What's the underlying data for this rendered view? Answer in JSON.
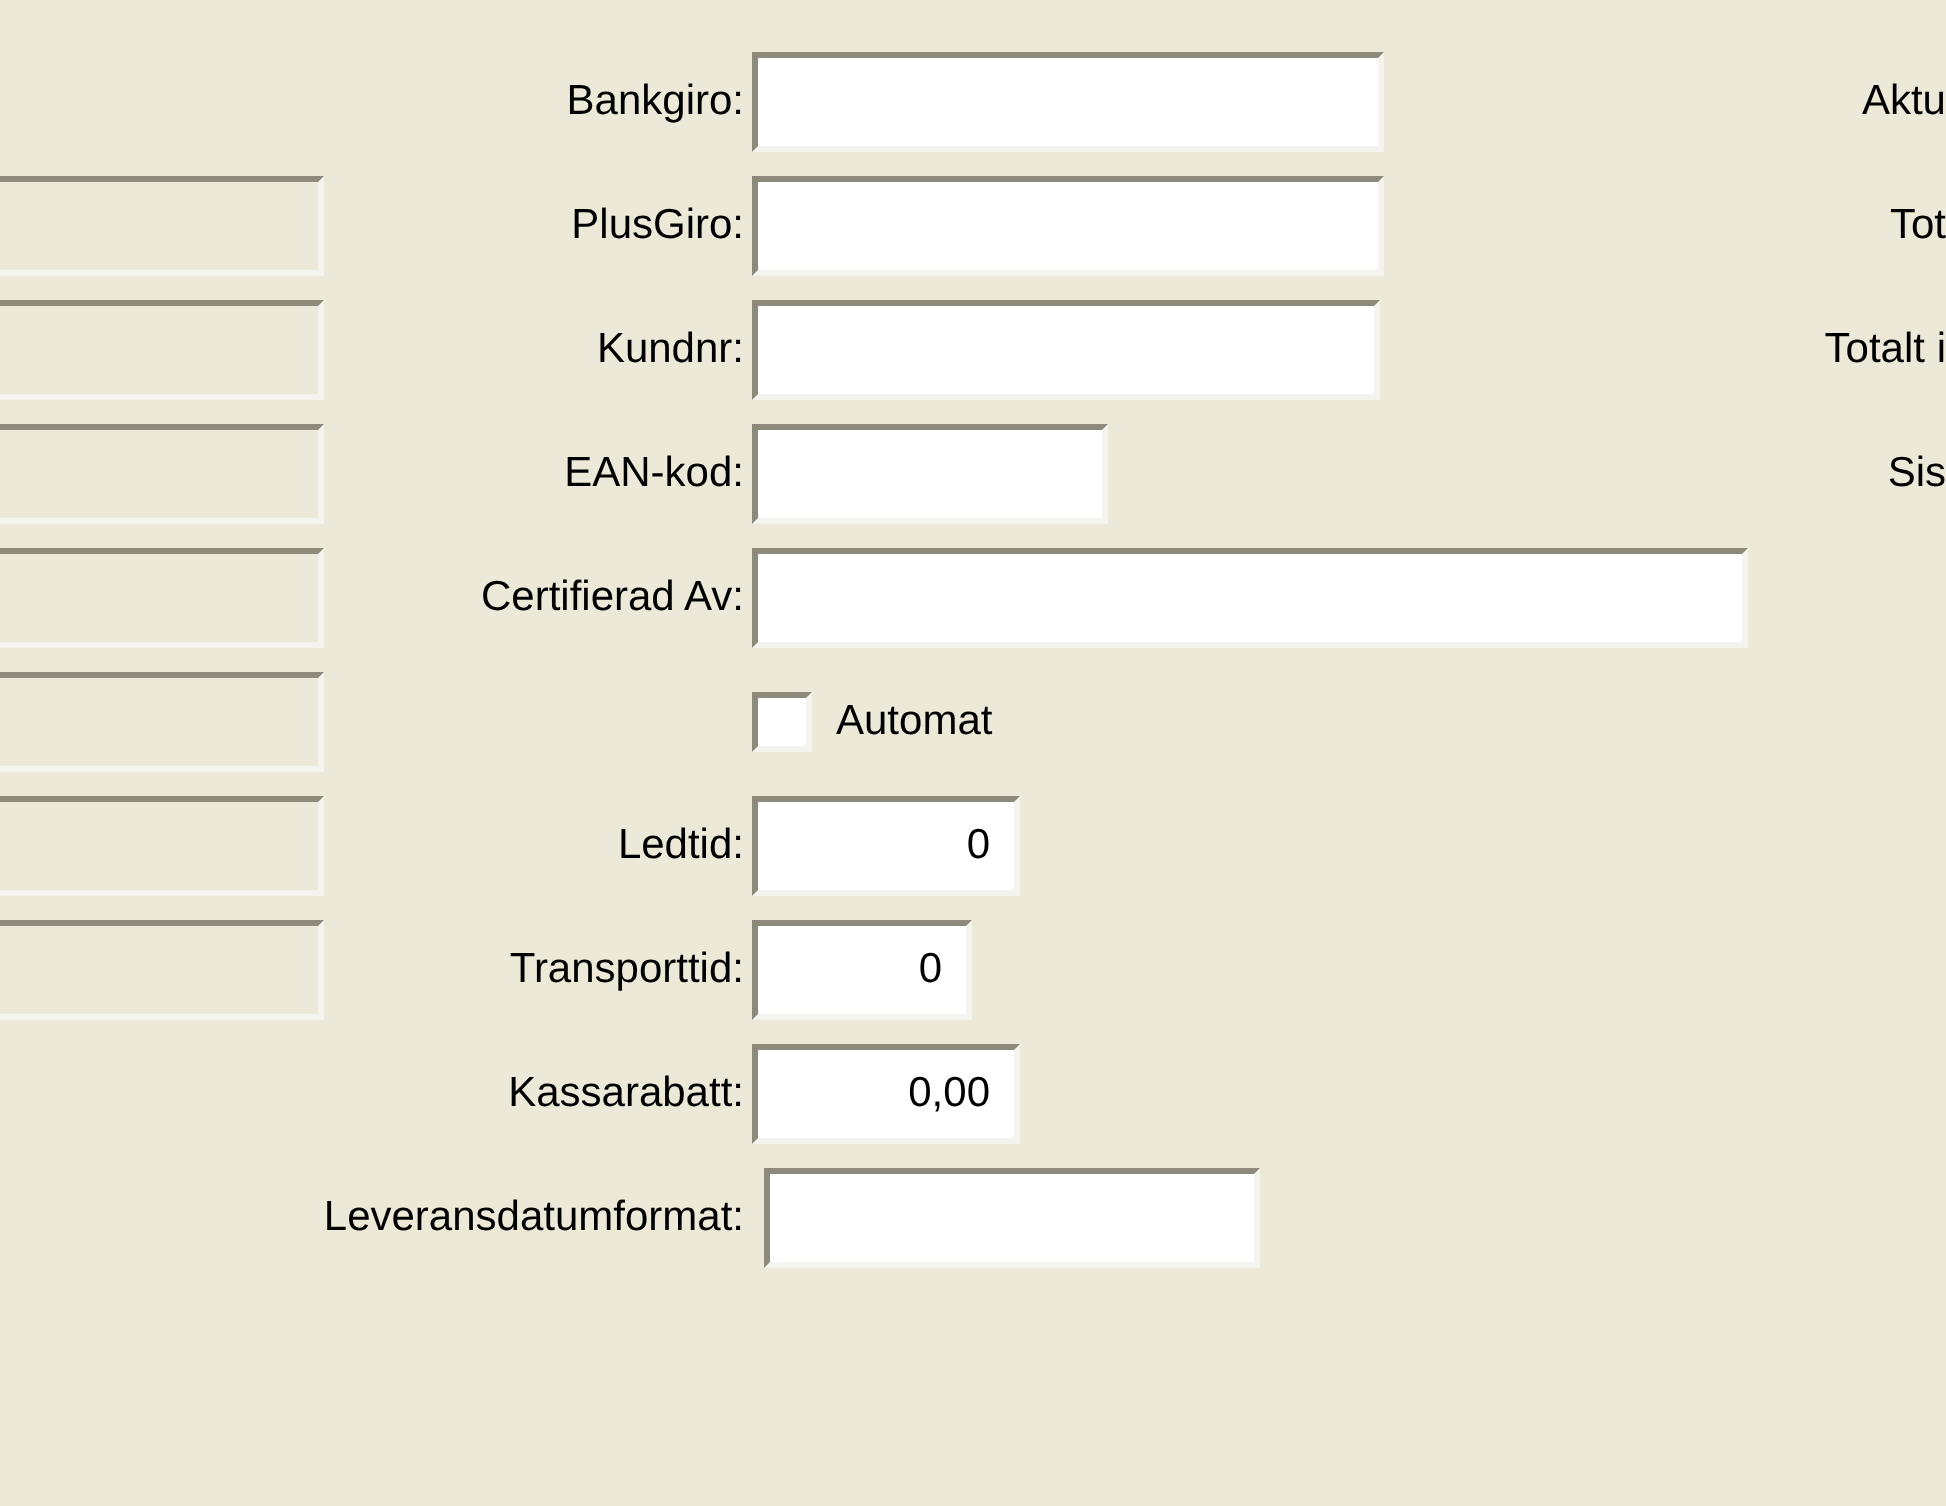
{
  "left_fields": [
    {
      "disabled": true
    },
    {
      "disabled": true
    },
    {
      "disabled": true
    },
    {
      "disabled": true
    },
    {
      "disabled": true
    },
    {
      "disabled": true
    },
    {
      "disabled": true
    }
  ],
  "fields": [
    {
      "kind": "text",
      "label": "Bankgiro:"
    },
    {
      "kind": "text",
      "label": "PlusGiro:"
    },
    {
      "kind": "text",
      "label": "Kundnr:"
    },
    {
      "kind": "text",
      "label": "EAN-kod:"
    },
    {
      "kind": "text",
      "label": "Certifierad Av:"
    },
    {
      "kind": "checkbox",
      "label": "Automat",
      "checked": false
    },
    {
      "kind": "number",
      "label": "Ledtid:",
      "value": "0"
    },
    {
      "kind": "number",
      "label": "Transporttid:",
      "value": "0"
    },
    {
      "kind": "number",
      "label": "Kassarabatt:",
      "value": "0,00"
    },
    {
      "kind": "text",
      "label": "Leveransdatumformat:"
    }
  ],
  "right_labels": [
    "Aktu",
    "Tot",
    "Totalt i",
    "Sis"
  ]
}
